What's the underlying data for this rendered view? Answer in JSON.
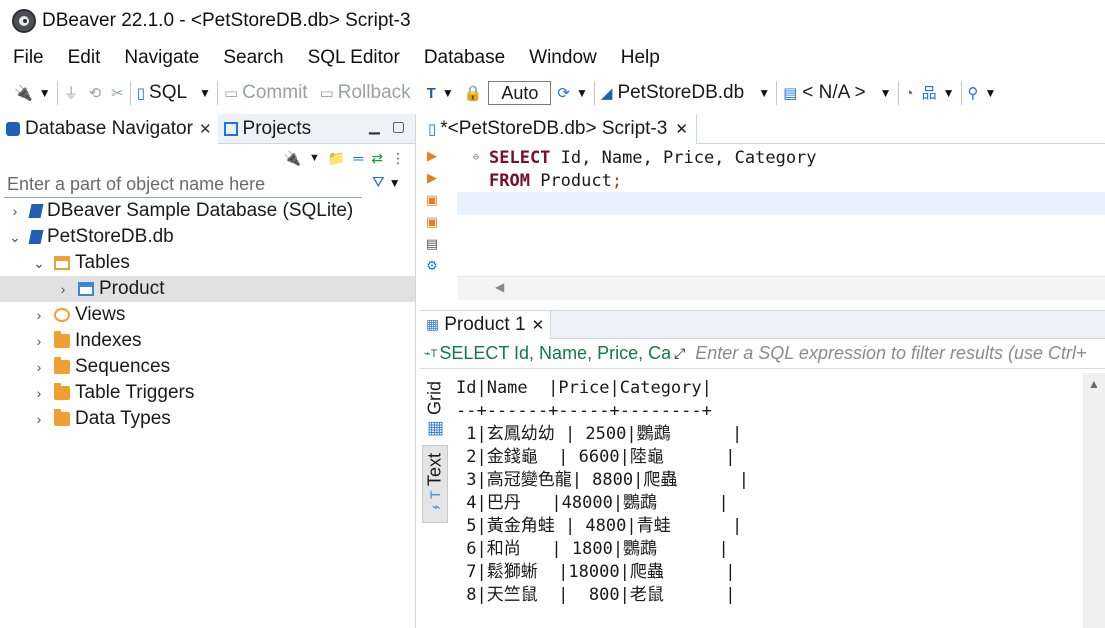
{
  "window": {
    "title": "DBeaver 22.1.0 - <PetStoreDB.db> Script-3"
  },
  "menu": [
    "File",
    "Edit",
    "Navigate",
    "Search",
    "SQL Editor",
    "Database",
    "Window",
    "Help"
  ],
  "toolbar": {
    "sql_label": "SQL",
    "commit_label": "Commit",
    "rollback_label": "Rollback",
    "auto_label": "Auto",
    "datasource_label": "PetStoreDB.db",
    "schema_label": "< N/A >"
  },
  "left": {
    "tab_navigator": "Database Navigator",
    "tab_projects": "Projects",
    "filter_placeholder": "Enter a part of object name here",
    "tree": [
      {
        "label": "DBeaver Sample Database (SQLite)",
        "level": 0,
        "expanded": false,
        "icon": "database"
      },
      {
        "label": "PetStoreDB.db",
        "level": 0,
        "expanded": true,
        "icon": "database"
      },
      {
        "label": "Tables",
        "level": 1,
        "expanded": true,
        "icon": "tables"
      },
      {
        "label": "Product",
        "level": 2,
        "expanded": false,
        "icon": "table",
        "selected": true
      },
      {
        "label": "Views",
        "level": 1,
        "expanded": false,
        "icon": "views"
      },
      {
        "label": "Indexes",
        "level": 1,
        "expanded": false,
        "icon": "folder"
      },
      {
        "label": "Sequences",
        "level": 1,
        "expanded": false,
        "icon": "folder"
      },
      {
        "label": "Table Triggers",
        "level": 1,
        "expanded": false,
        "icon": "folder"
      },
      {
        "label": "Data Types",
        "level": 1,
        "expanded": false,
        "icon": "folder"
      }
    ]
  },
  "editor": {
    "tab_label": "*<PetStoreDB.db> Script-3",
    "lines": [
      {
        "kw": "SELECT",
        "rest": " Id, Name, Price, Category"
      },
      {
        "kw": "FROM",
        "rest": " Product",
        "tail": ";"
      },
      {
        "kw": "",
        "rest": ""
      }
    ]
  },
  "results": {
    "tab_label": "Product 1",
    "query_label": "SELECT Id, Name, Price, Ca",
    "filter_placeholder": "Enter a SQL expression to filter results (use Ctrl+",
    "side_tab_grid": "Grid",
    "side_tab_text": "Text",
    "text_lines": [
      "Id|Name  |Price|Category|",
      "--+------+-----+--------+",
      " 1|玄鳳幼幼 | 2500|鸚鵡      |",
      " 2|金錢龜  | 6600|陸龜      |",
      " 3|高冠變色龍| 8800|爬蟲      |",
      " 4|巴丹   |48000|鸚鵡      |",
      " 5|黃金角蛙 | 4800|青蛙      |",
      " 6|和尚   | 1800|鸚鵡      |",
      " 7|鬆獅蜥  |18000|爬蟲      |",
      " 8|天竺鼠  |  800|老鼠      |"
    ]
  }
}
